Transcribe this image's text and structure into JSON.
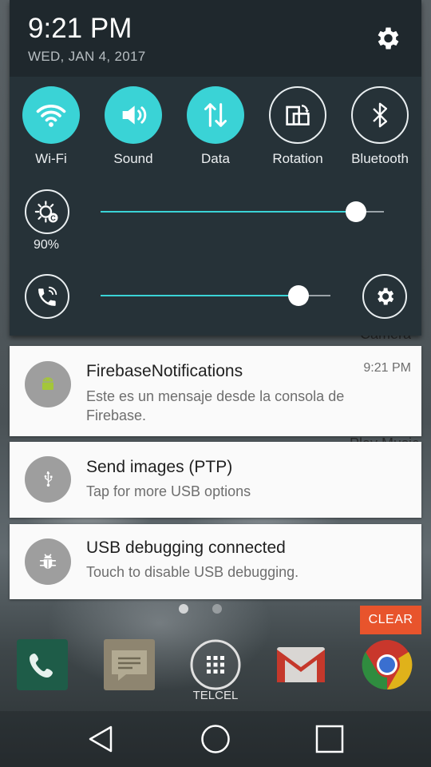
{
  "status": {
    "time": "9:21 PM",
    "date": "WED, JAN 4, 2017"
  },
  "quick_settings": {
    "tiles": [
      {
        "label": "Wi-Fi",
        "icon": "wifi-icon",
        "active": true
      },
      {
        "label": "Sound",
        "icon": "volume-icon",
        "active": true
      },
      {
        "label": "Data",
        "icon": "data-transfer-icon",
        "active": true
      },
      {
        "label": "Rotation",
        "icon": "rotation-icon",
        "active": false
      },
      {
        "label": "Bluetooth",
        "icon": "bluetooth-icon",
        "active": false
      }
    ],
    "brightness": {
      "percent_label": "90%",
      "level": 0.9
    },
    "volume": {
      "level": 0.86
    }
  },
  "notifications": [
    {
      "app_icon": "android-icon",
      "title": "FirebaseNotifications",
      "text": "Este es un mensaje desde la consola de Firebase.",
      "time": "9:21 PM"
    },
    {
      "app_icon": "usb-icon",
      "title": "Send images (PTP)",
      "text": "Tap for more USB options"
    },
    {
      "app_icon": "bug-icon",
      "title": "USB debugging connected",
      "text": "Touch to disable USB debugging."
    }
  ],
  "clear_label": "CLEAR",
  "home": {
    "carrier": "TELCEL",
    "dock": [
      "phone-icon",
      "messaging-icon",
      "apps-icon",
      "gmail-icon",
      "chrome-icon"
    ]
  },
  "background_partial_labels": {
    "camera": "Camera",
    "play_music": "Play Music"
  },
  "colors": {
    "accent": "#3ad3d6",
    "panel": "#263238",
    "clear": "#e8542c"
  }
}
